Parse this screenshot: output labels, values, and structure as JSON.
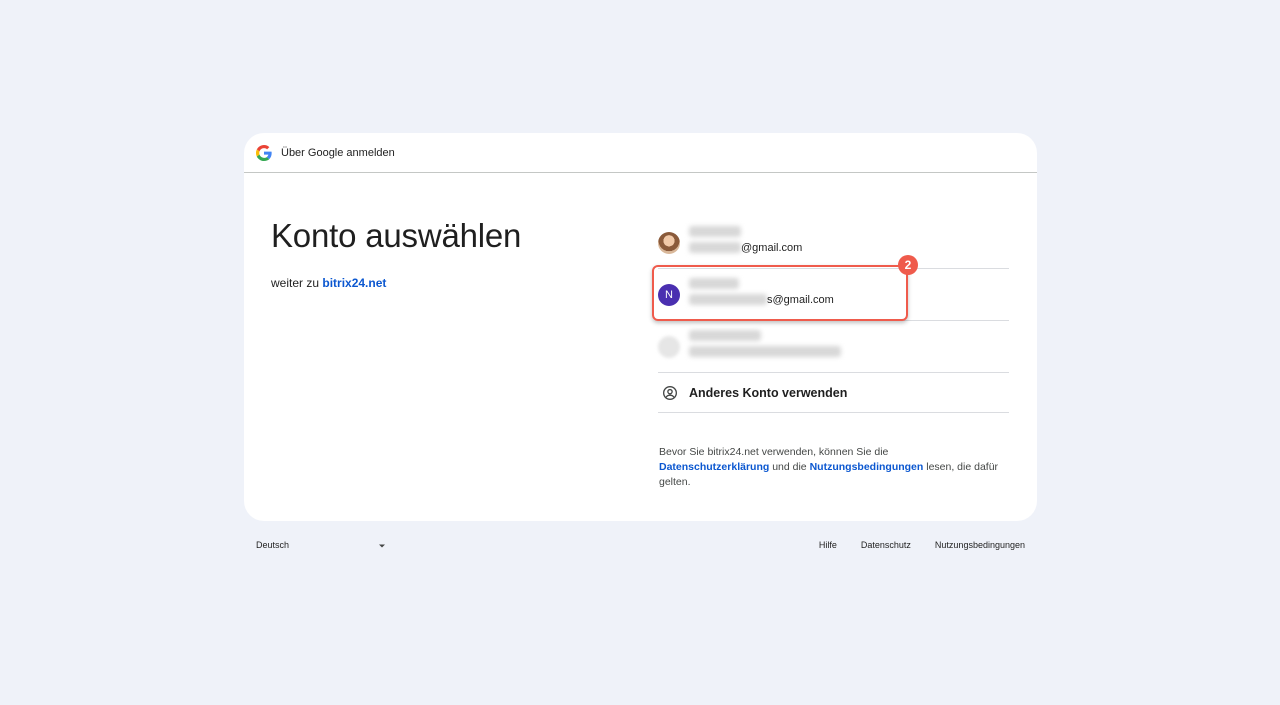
{
  "header": {
    "title": "Über Google anmelden"
  },
  "main": {
    "title": "Konto auswählen",
    "subtitle_prefix": "weiter zu",
    "subtitle_link": "bitrix24.net"
  },
  "accounts": [
    {
      "email_suffix": "@gmail.com",
      "avatar": "photo"
    },
    {
      "email_suffix": "s@gmail.com",
      "avatar": "N"
    },
    {
      "email_suffix": "",
      "avatar": "blurred"
    }
  ],
  "other_account": {
    "label": "Anderes Konto verwenden",
    "icon": "account-circle-icon"
  },
  "annotation": {
    "step": "2",
    "color": "#ef5b4c"
  },
  "legal": {
    "part1": "Bevor Sie bitrix24.net verwenden, können Sie die",
    "privacy_link": "Datenschutzerklärung",
    "part2": "und die",
    "terms_link": "Nutzungsbedingungen",
    "part3": "lesen, die dafür gelten."
  },
  "footer": {
    "language": "Deutsch",
    "links": [
      "Hilfe",
      "Datenschutz",
      "Nutzungsbedingungen"
    ]
  },
  "colors": {
    "background": "#eff2f9",
    "link": "#0b57d0",
    "avatar_letter_bg": "#4a2fb0"
  }
}
